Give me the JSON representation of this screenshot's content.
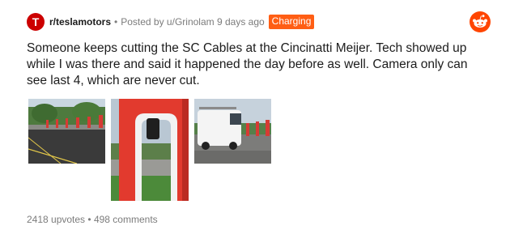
{
  "post": {
    "subreddit": "r/teslamotors",
    "subreddit_icon_letter": "T",
    "separator": "•",
    "posted_by": "Posted by u/Grinolam 9 days ago",
    "flair": "Charging",
    "title": "Someone keeps cutting the SC Cables at the Cincinatti Meijer. Tech showed up while I was there and said it happened the day before as well. Camera only can see last 4, which are never cut.",
    "upvotes": "2418 upvotes",
    "comments": "498 comments",
    "footer_separator": "•"
  },
  "icons": {
    "subreddit_icon": "tesla-logo-icon",
    "app_icon": "reddit-snoo-icon"
  },
  "colors": {
    "flair_bg": "#ff5e14",
    "subreddit_icon_bg": "#cc0000",
    "reddit_orange": "#ff4500",
    "meta_gray": "#7c7c7c"
  }
}
